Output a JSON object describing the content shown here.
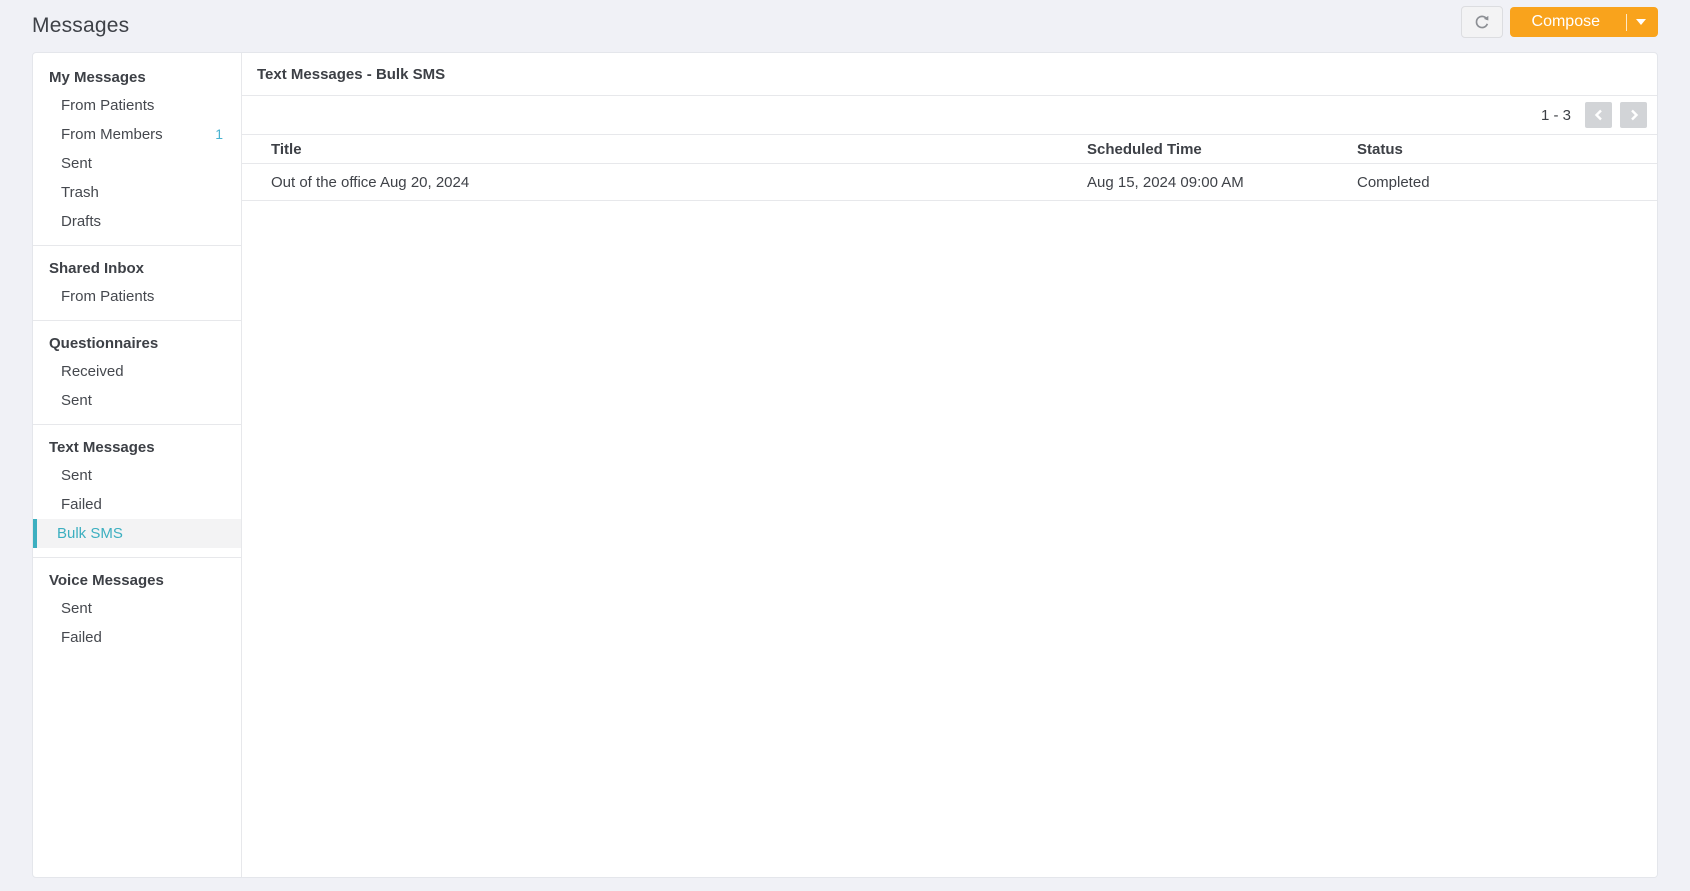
{
  "page": {
    "title": "Messages"
  },
  "toolbar": {
    "compose_label": "Compose"
  },
  "sidebar": {
    "sections": [
      {
        "header": "My Messages",
        "items": [
          {
            "label": "From Patients"
          },
          {
            "label": "From Members",
            "badge": "1"
          },
          {
            "label": "Sent"
          },
          {
            "label": "Trash"
          },
          {
            "label": "Drafts"
          }
        ]
      },
      {
        "header": "Shared Inbox",
        "items": [
          {
            "label": "From Patients"
          }
        ]
      },
      {
        "header": "Questionnaires",
        "items": [
          {
            "label": "Received"
          },
          {
            "label": "Sent"
          }
        ]
      },
      {
        "header": "Text Messages",
        "items": [
          {
            "label": "Sent"
          },
          {
            "label": "Failed"
          },
          {
            "label": "Bulk SMS",
            "selected": true
          }
        ]
      },
      {
        "header": "Voice Messages",
        "items": [
          {
            "label": "Sent"
          },
          {
            "label": "Failed"
          }
        ]
      }
    ]
  },
  "main": {
    "header": "Text Messages - Bulk SMS",
    "pagination": {
      "range": "1 - 3"
    },
    "table": {
      "columns": [
        "Title",
        "Scheduled Time",
        "Status"
      ],
      "rows": [
        {
          "title": "Out of the office Aug 20, 2024",
          "scheduled_time": "Aug 15, 2024 09:00 AM",
          "status": "Completed"
        }
      ]
    }
  },
  "colors": {
    "accent_orange": "#f9a31c",
    "accent_teal": "#3cafc0",
    "badge_teal": "#49b3d1",
    "page_background": "#f0f1f6",
    "card_border": "#e4e6eb",
    "text_dark": "#3d4046"
  }
}
